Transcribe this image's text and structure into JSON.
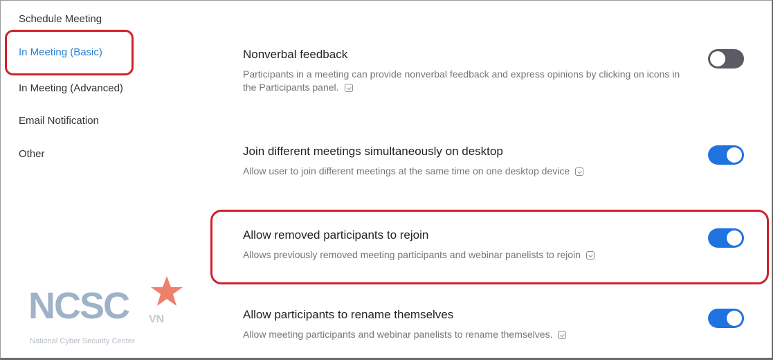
{
  "sidebar": {
    "items": [
      {
        "label": "Schedule Meeting",
        "active": false
      },
      {
        "label": "In Meeting (Basic)",
        "active": true
      },
      {
        "label": "In Meeting (Advanced)",
        "active": false
      },
      {
        "label": "Email Notification",
        "active": false
      },
      {
        "label": "Other",
        "active": false
      }
    ]
  },
  "settings": [
    {
      "title": "Nonverbal feedback",
      "description": "Participants in a meeting can provide nonverbal feedback and express opinions by clicking on icons in the Participants panel.",
      "enabled": false
    },
    {
      "title": "Join different meetings simultaneously on desktop",
      "description": "Allow user to join different meetings at the same time on one desktop device",
      "enabled": true
    },
    {
      "title": "Allow removed participants to rejoin",
      "description": "Allows previously removed meeting participants and webinar panelists to rejoin",
      "enabled": true
    },
    {
      "title": "Allow participants to rename themselves",
      "description": "Allow meeting participants and webinar panelists to rename themselves.",
      "enabled": true
    }
  ],
  "watermark": {
    "logo_text": "NCSC",
    "logo_suffix": "VN",
    "subtitle": "National Cyber Security Center"
  },
  "colors": {
    "accent": "#2D7ED0",
    "toggle_on": "#1F73E0",
    "toggle_off": "#5b5b63",
    "annotation": "#D0202A",
    "watermark_star": "#E8553B"
  }
}
